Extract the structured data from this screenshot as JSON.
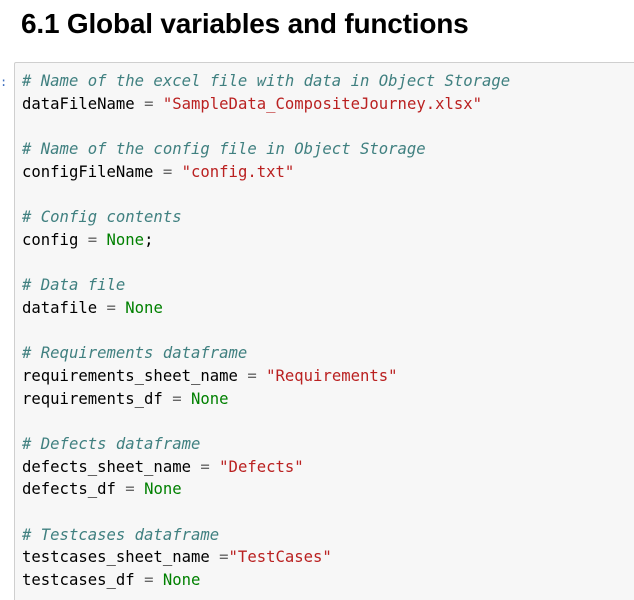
{
  "heading": "6.1 Global variables and functions",
  "prompt_marker": ":",
  "code": {
    "comment_data_file": "# Name of the excel file with data in Object Storage",
    "data_file_var": "dataFileName",
    "data_file_value": "\"SampleData_CompositeJourney.xlsx\"",
    "comment_config_file": "# Name of the config file in Object Storage",
    "config_file_var": "configFileName",
    "config_file_value": "\"config.txt\"",
    "comment_config_contents": "# Config contents",
    "config_var": "config",
    "config_value": "None",
    "config_semicolon": ";",
    "comment_data": "# Data file",
    "datafile_var": "datafile",
    "datafile_value": "None",
    "comment_requirements": "# Requirements dataframe",
    "req_sheet_var": "requirements_sheet_name",
    "req_sheet_value": "\"Requirements\"",
    "req_df_var": "requirements_df",
    "req_df_value": "None",
    "comment_defects": "# Defects dataframe",
    "def_sheet_var": "defects_sheet_name",
    "def_sheet_value": "\"Defects\"",
    "def_df_var": "defects_df",
    "def_df_value": "None",
    "comment_testcases": "# Testcases dataframe",
    "tc_sheet_var": "testcases_sheet_name",
    "tc_sheet_value": "\"TestCases\"",
    "tc_df_var": "testcases_df",
    "tc_df_value": "None",
    "assign_op": "="
  },
  "colors": {
    "comment": "#408080",
    "string": "#ba2121",
    "keyword": "#008000",
    "operator": "#666666",
    "cell_background": "#f7f7f7",
    "cell_border": "#cfcfcf"
  }
}
